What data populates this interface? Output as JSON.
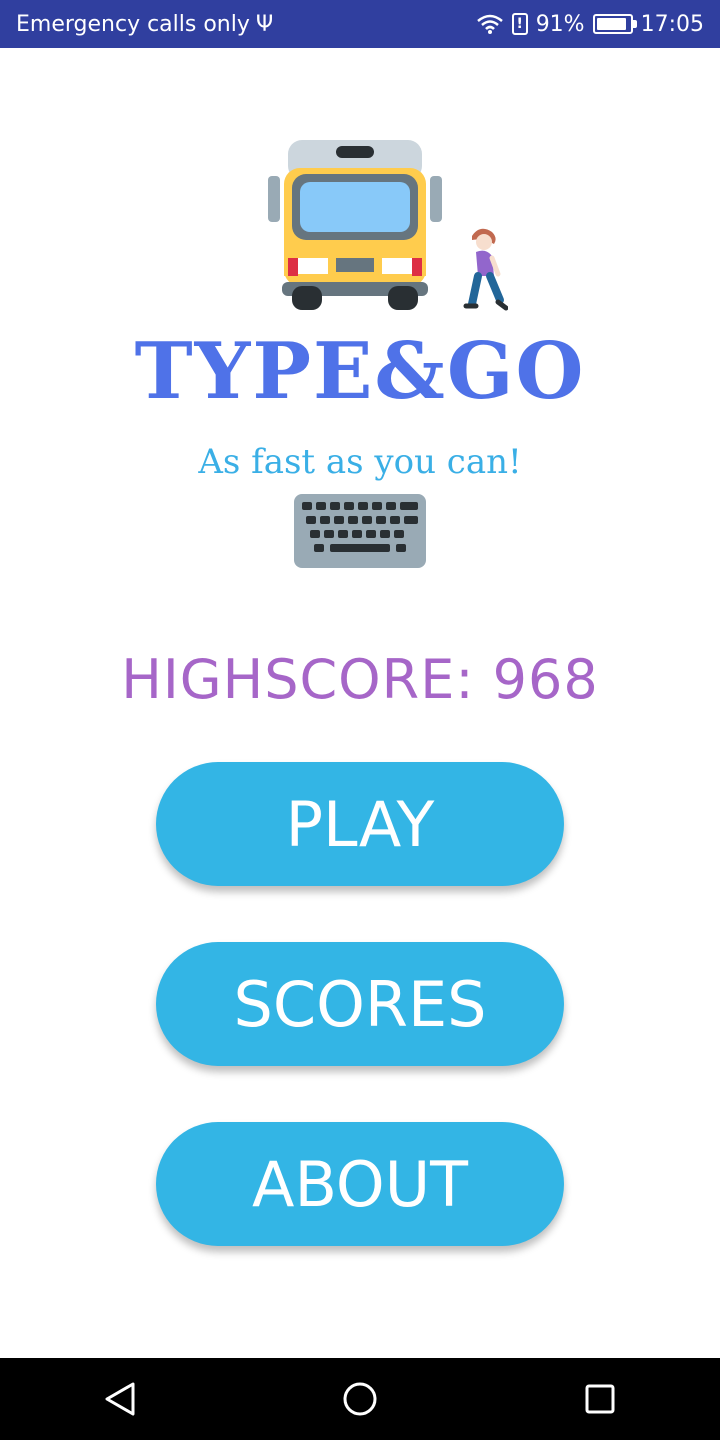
{
  "status_bar": {
    "carrier_text": "Emergency calls only",
    "battery_percent": "91%",
    "time": "17:05",
    "icons": [
      "usb-icon",
      "wifi-icon",
      "alert-icon",
      "battery-icon"
    ]
  },
  "logo": {
    "title": "TYPE&GO",
    "tagline": "As fast as you can!",
    "icons": [
      "bus-icon",
      "person-walking-icon",
      "keyboard-icon"
    ]
  },
  "highscore": {
    "text": "HIGHSCORE: 968"
  },
  "menu": {
    "play_label": "PLAY",
    "scores_label": "SCORES",
    "about_label": "ABOUT"
  },
  "nav_bar": {
    "icons": [
      "back-icon",
      "home-icon",
      "recents-icon"
    ]
  },
  "colors": {
    "status_bar": "#303F9F",
    "title": "#4F72E8",
    "tagline": "#3AAFE6",
    "highscore": "#A666C8",
    "button": "#33B5E5"
  }
}
